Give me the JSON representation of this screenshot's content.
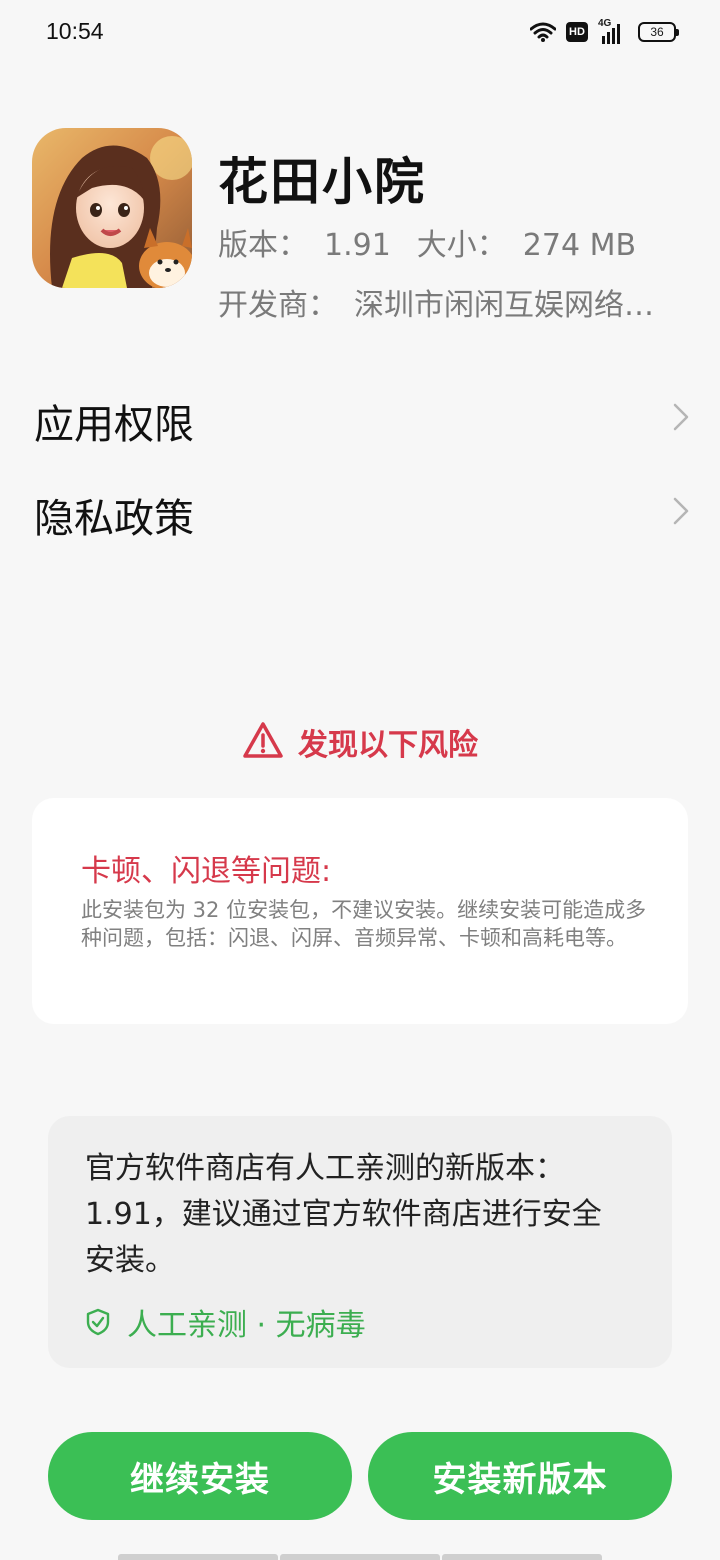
{
  "status_bar": {
    "time": "10:54",
    "hd": "HD",
    "network": "4G",
    "battery": "36"
  },
  "app": {
    "name": "花田小院",
    "version_label": "版本：",
    "version": "1.91",
    "size_label": "大小：",
    "size": "274 MB",
    "developer_label": "开发商：",
    "developer": "深圳市闲闲互娱网络…"
  },
  "menu": {
    "permissions": "应用权限",
    "privacy": "隐私政策"
  },
  "risk": {
    "header": "发现以下风险",
    "title": "卡顿、闪退等问题:",
    "description": "此安装包为 32 位安装包，不建议安装。继续安装可能造成多种问题，包括：闪退、闪屏、音频异常、卡顿和高耗电等。"
  },
  "recommend": {
    "text": "官方软件商店有人工亲测的新版本：1.91，建议通过官方软件商店进行安全安装。",
    "badge": "人工亲测 · 无病毒"
  },
  "buttons": {
    "continue": "继续安装",
    "install_new": "安装新版本"
  },
  "colors": {
    "risk_red": "#d6394b",
    "accent_green": "#3bbf55",
    "badge_green": "#3cae50"
  },
  "icons": [
    "wifi-icon",
    "hd-icon",
    "signal-icon",
    "battery-icon",
    "app-icon",
    "chevron-right-icon",
    "warning-icon",
    "shield-check-icon"
  ]
}
